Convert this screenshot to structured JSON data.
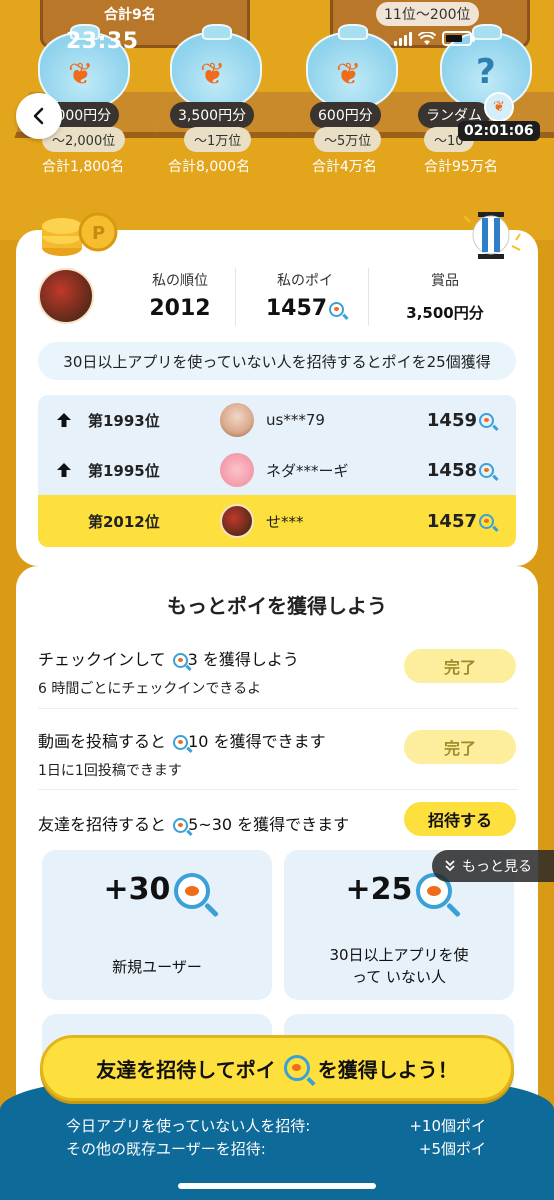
{
  "status": {
    "time": "23:35"
  },
  "top": {
    "left_total": "合計9名",
    "right_range": "11位〜200位",
    "timer": "02:01:06",
    "prizes": [
      {
        "price": ",000円分",
        "rank": "〜2,000位",
        "total": "合計1,800名"
      },
      {
        "price": "3,500円分",
        "rank": "〜1万位",
        "total": "合計8,000名"
      },
      {
        "price": "600円分",
        "rank": "〜5万位",
        "total": "合計4万名"
      },
      {
        "price": "ランダム",
        "rank": "〜10",
        "total": "合計95万名"
      }
    ]
  },
  "me": {
    "rank_label": "私の順位",
    "rank": "2012",
    "poi_label": "私のポイ",
    "poi": "1457",
    "prize_label": "賞品",
    "prize": "3,500円分"
  },
  "invite_note": "30日以上アプリを使っていない人を招待するとポイを25個獲得",
  "ranking": [
    {
      "rank": "第1993位",
      "user": "us***79",
      "points": "1459",
      "arrow": true
    },
    {
      "rank": "第1995位",
      "user": "ネダ***ーギ",
      "points": "1458",
      "arrow": true
    },
    {
      "rank": "第2012位",
      "user": "せ***",
      "points": "1457",
      "arrow": false
    }
  ],
  "tasks": {
    "title": "もっとポイを獲得しよう",
    "checkin": {
      "pre": "チェックインして",
      "num": "3",
      "post": "を獲得しよう",
      "sub": "6 時間ごとにチェックインできるよ",
      "button": "完了"
    },
    "video": {
      "pre": "動画を投稿すると",
      "num": "10",
      "post": "を獲得できます",
      "sub": "1日に1回投稿できます",
      "button": "完了"
    },
    "friend": {
      "pre": "友達を招待すると",
      "num": "5~30",
      "post": "を獲得できます",
      "button": "招待する"
    },
    "more": "もっと見る",
    "rewards": [
      {
        "amount": "+30",
        "desc": "新規ユーザー"
      },
      {
        "amount": "+25",
        "desc": "30日以上アプリを使って いない人"
      }
    ]
  },
  "cta": {
    "pre": "友達を招待してポイ",
    "post": "を獲得しよう！"
  },
  "bottom": [
    {
      "label": "今日アプリを使っていない人を招待:",
      "value": "+10個ポイ"
    },
    {
      "label": "その他の既存ユーザーを招待:",
      "value": "+5個ポイ"
    }
  ]
}
